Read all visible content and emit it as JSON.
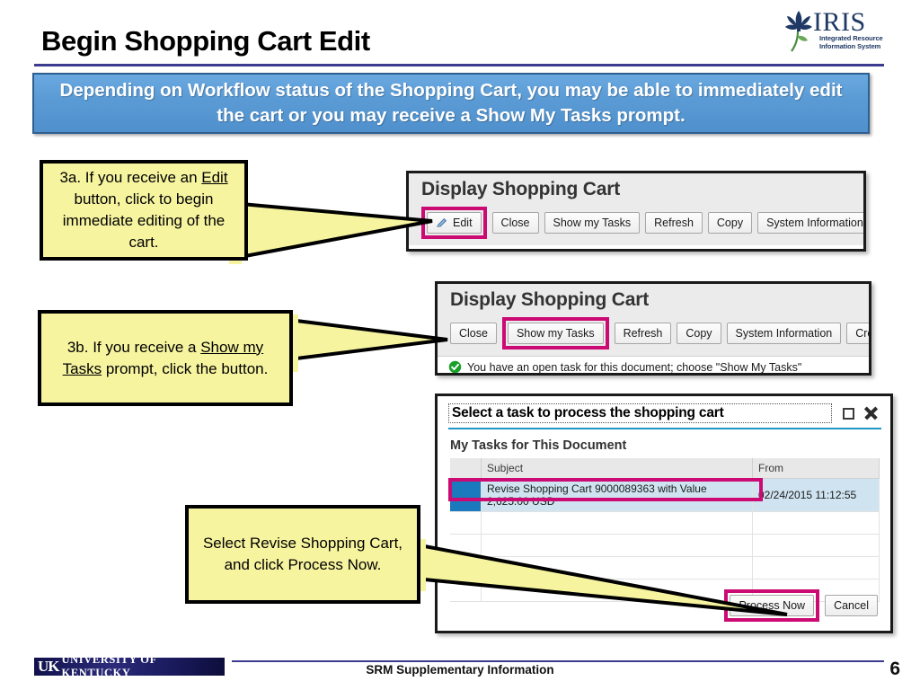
{
  "slide": {
    "title": "Begin Shopping Cart Edit",
    "banner_text": "Depending on Workflow status of the Shopping Cart, you may be able to immediately edit the cart or you may receive a Show My Tasks prompt."
  },
  "logo": {
    "wordmark": "IRIS",
    "subtitle_line1": "Integrated Resource",
    "subtitle_line2": "Information System",
    "flower_icon": "iris-flower-icon",
    "color": "#1f3864"
  },
  "callouts": [
    {
      "id": "3a",
      "segments": [
        {
          "text": "3a. If you receive an ",
          "underline": false
        },
        {
          "text": "Edit",
          "underline": true
        },
        {
          "text": " button, click to begin immediate editing of the cart.",
          "underline": false
        }
      ]
    },
    {
      "id": "3b",
      "segments": [
        {
          "text": "3b. If you receive a ",
          "underline": false
        },
        {
          "text": "Show my Tasks",
          "underline": true
        },
        {
          "text": " prompt, click the button.",
          "underline": false
        }
      ]
    },
    {
      "id": "process",
      "segments": [
        {
          "text": "Select Revise Shopping Cart, and click Process Now.",
          "underline": false
        }
      ]
    }
  ],
  "panel_edit": {
    "title": "Display Shopping Cart",
    "buttons": [
      {
        "label": "Edit",
        "icon": "pencil-icon",
        "highlighted": true
      },
      {
        "label": "Close",
        "icon": null,
        "highlighted": false
      },
      {
        "label": "Show my Tasks",
        "icon": null,
        "highlighted": false
      },
      {
        "label": "Refresh",
        "icon": null,
        "highlighted": false
      },
      {
        "label": "Copy",
        "icon": null,
        "highlighted": false
      },
      {
        "label": "System Information",
        "icon": null,
        "highlighted": false
      }
    ]
  },
  "panel_tasks": {
    "title": "Display Shopping Cart",
    "buttons": [
      {
        "label": "Close",
        "highlighted": false
      },
      {
        "label": "Show my Tasks",
        "highlighted": true
      },
      {
        "label": "Refresh",
        "highlighted": false
      },
      {
        "label": "Copy",
        "highlighted": false
      },
      {
        "label": "System Information",
        "highlighted": false
      },
      {
        "label": "Create",
        "highlighted": false
      }
    ],
    "message": "You have an open task for this document; choose \"Show My Tasks\"",
    "message_icon": "green-check-icon"
  },
  "dialog": {
    "title": "Select a task to process the shopping cart",
    "maximize_icon": "maximize-icon",
    "close_icon": "close-icon",
    "subtitle": "My Tasks for This Document",
    "columns": [
      "",
      "Subject",
      "From"
    ],
    "rows": [
      {
        "selected": true,
        "subject": "Revise Shopping Cart 9000089363 with Value 2,625.00 USD",
        "from": "02/24/2015 11:12:55"
      },
      {
        "selected": false,
        "subject": "",
        "from": ""
      },
      {
        "selected": false,
        "subject": "",
        "from": ""
      },
      {
        "selected": false,
        "subject": "",
        "from": ""
      },
      {
        "selected": false,
        "subject": "",
        "from": ""
      }
    ],
    "buttons": [
      {
        "label": "Process Now",
        "highlighted": true
      },
      {
        "label": "Cancel",
        "highlighted": false
      }
    ]
  },
  "footer": {
    "university_abbr": "UK",
    "university_name": "UNIVERSITY OF KENTUCKY",
    "center_text": "SRM Supplementary Information",
    "page_number": "6"
  },
  "colors": {
    "highlight": "#cc0a73",
    "banner_blue": "#5b9bd5",
    "rule_navy": "#3b3b8f",
    "callout_yellow": "#f7f4a0",
    "dialog_rule": "#2196c9",
    "row_selected": "#cfe4f0"
  }
}
